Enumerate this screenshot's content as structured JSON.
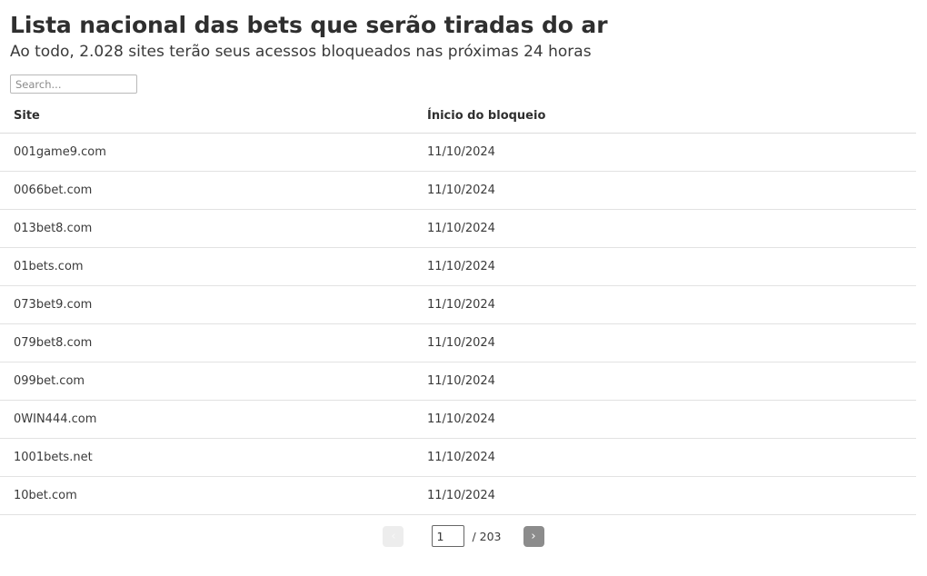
{
  "header": {
    "title": "Lista nacional das bets que serão tiradas do ar",
    "subtitle": "Ao todo, 2.028 sites terão seus acessos bloqueados nas próximas 24 horas"
  },
  "search": {
    "placeholder": "Search...",
    "value": ""
  },
  "table": {
    "columns": [
      {
        "key": "site",
        "label": "Site"
      },
      {
        "key": "date",
        "label": "Ínicio do bloqueio"
      }
    ],
    "rows": [
      {
        "site": "001game9.com",
        "date": "11/10/2024"
      },
      {
        "site": "0066bet.com",
        "date": "11/10/2024"
      },
      {
        "site": "013bet8.com",
        "date": "11/10/2024"
      },
      {
        "site": "01bets.com",
        "date": "11/10/2024"
      },
      {
        "site": "073bet9.com",
        "date": "11/10/2024"
      },
      {
        "site": "079bet8.com",
        "date": "11/10/2024"
      },
      {
        "site": "099bet.com",
        "date": "11/10/2024"
      },
      {
        "site": "0WIN444.com",
        "date": "11/10/2024"
      },
      {
        "site": "1001bets.net",
        "date": "11/10/2024"
      },
      {
        "site": "10bet.com",
        "date": "11/10/2024"
      }
    ]
  },
  "pagination": {
    "prev_icon": "chevron-left",
    "prev_glyph": "‹",
    "next_icon": "chevron-right",
    "next_glyph": "›",
    "current_page": "1",
    "total_label": "/ 203",
    "total_pages": 203,
    "prev_disabled": true,
    "next_disabled": false
  },
  "colors": {
    "text_primary": "#2f2f2f",
    "text_secondary": "#3a3a3a",
    "row_border": "#e2e2e2",
    "header_border": "#dcdcdc",
    "prev_button_bg": "#ededed",
    "next_button_bg": "#8c8c8c",
    "background": "#ffffff"
  }
}
